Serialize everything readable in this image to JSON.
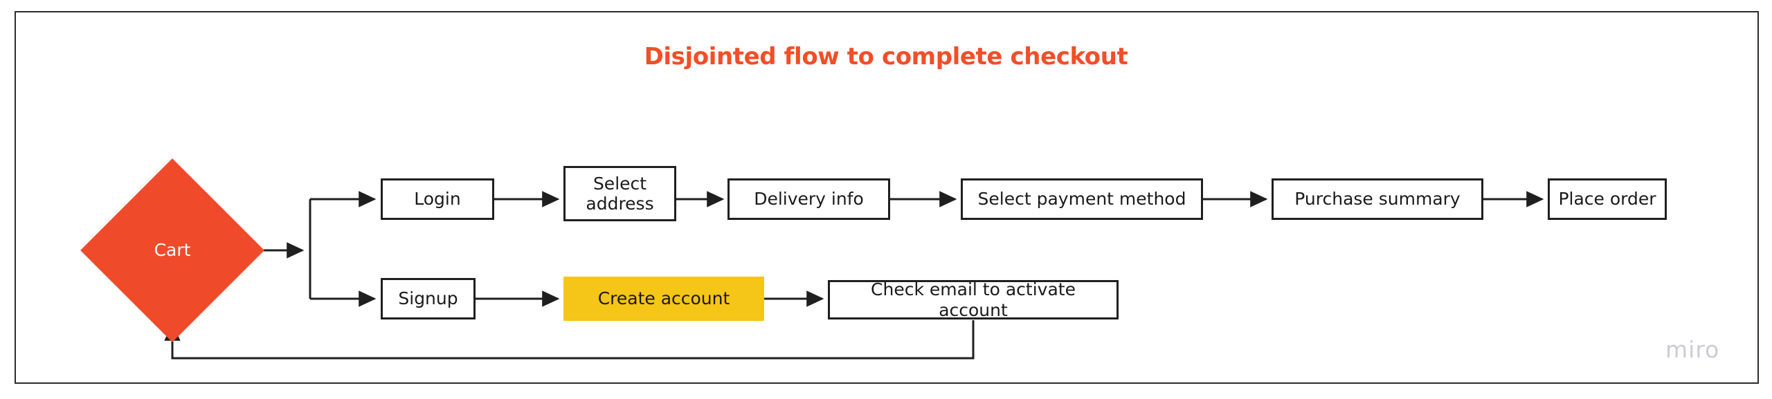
{
  "diagram": {
    "title": "Disjointed flow to complete checkout",
    "watermark": "miro",
    "colors": {
      "title": "#f24e28",
      "decision_fill": "#ef4b2b",
      "decision_text": "#ffffff",
      "highlight_fill": "#f5c518",
      "node_stroke": "#1f1f1f",
      "frame_stroke": "#2b2b2b",
      "connector": "#1f1f1f",
      "watermark": "#cbccd6",
      "canvas": "#ffffff"
    },
    "nodes": {
      "cart": {
        "label": "Cart",
        "shape": "diamond"
      },
      "login": {
        "label": "Login",
        "shape": "rect"
      },
      "select_address": {
        "label": "Select\naddress",
        "shape": "rect"
      },
      "delivery_info": {
        "label": "Delivery info",
        "shape": "rect"
      },
      "select_payment_method": {
        "label": "Select payment method",
        "shape": "rect"
      },
      "purchase_summary": {
        "label": "Purchase summary",
        "shape": "rect"
      },
      "place_order": {
        "label": "Place order",
        "shape": "rect"
      },
      "signup": {
        "label": "Signup",
        "shape": "rect"
      },
      "create_account": {
        "label": "Create account",
        "shape": "rect-filled"
      },
      "check_email": {
        "label": "Check email to activate account",
        "shape": "rect"
      }
    },
    "edges": [
      {
        "from": "cart",
        "to": "login"
      },
      {
        "from": "cart",
        "to": "signup"
      },
      {
        "from": "login",
        "to": "select_address"
      },
      {
        "from": "select_address",
        "to": "delivery_info"
      },
      {
        "from": "delivery_info",
        "to": "select_payment_method"
      },
      {
        "from": "select_payment_method",
        "to": "purchase_summary"
      },
      {
        "from": "purchase_summary",
        "to": "place_order"
      },
      {
        "from": "signup",
        "to": "create_account"
      },
      {
        "from": "create_account",
        "to": "check_email"
      },
      {
        "from": "check_email",
        "to": "cart"
      }
    ]
  }
}
